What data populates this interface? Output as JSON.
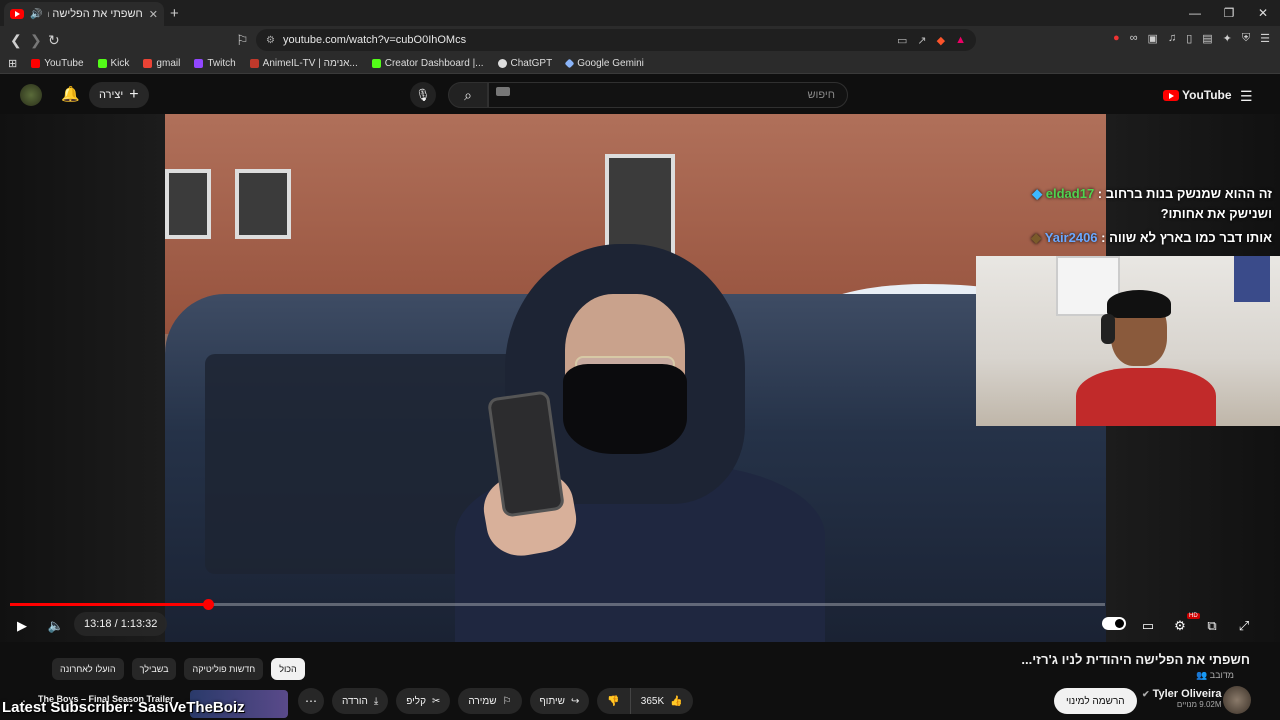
{
  "browser": {
    "tab_title": "חשפתי את הפלישה היהודית",
    "url": "youtube.com/watch?v=cubO0IhOMcs",
    "bookmarks": [
      {
        "label": "YouTube",
        "color": "#ff0000"
      },
      {
        "label": "Kick",
        "color": "#53fc18"
      },
      {
        "label": "gmail",
        "color": "#ea4335"
      },
      {
        "label": "Twitch",
        "color": "#9146ff"
      },
      {
        "label": "AnimeIL-TV | אנימה...",
        "color": "#c0392b"
      },
      {
        "label": "Creator Dashboard |...",
        "color": "#53fc18"
      },
      {
        "label": "ChatGPT",
        "color": "#dddddd"
      },
      {
        "label": "Google Gemini",
        "color": "#8ab4f8"
      }
    ]
  },
  "yt_header": {
    "create_label": "יצירה",
    "search_placeholder": "חיפוש"
  },
  "player": {
    "time": "13:18 / 1:13:32",
    "progress_fraction": 0.181
  },
  "overlay": {
    "chat": [
      {
        "user": "eldad17",
        "message": "זה ההוא שמנשק בנות ברחוב : ",
        "message2": "ושנישק את אחותו?"
      },
      {
        "user": "Yair2406",
        "message": "אותו דבר כמו בארץ לא שווה : "
      }
    ],
    "logo_text": "YouTube",
    "latest_subscriber": "Latest Subscriber: SasiVeTheBoiz"
  },
  "video": {
    "title": "חשפתי את הפלישה היהודית לניו ג'רזי...",
    "dubbed": "מדובב",
    "channel_name": "Tyler Oliveira",
    "subscribers": "9.02M מנויים",
    "subscribe_label": "הרשמה למינוי",
    "likes": "365K",
    "share_label": "שיתוף",
    "save_label": "שמירה",
    "clip_label": "קליפ",
    "download_label": "הורדה",
    "next_trailer": "The Boys – Final Season Trailer"
  },
  "chips": [
    "הכול",
    "חדשות פוליטיקה",
    "בשבילך",
    "הועלו לאחרונה"
  ]
}
